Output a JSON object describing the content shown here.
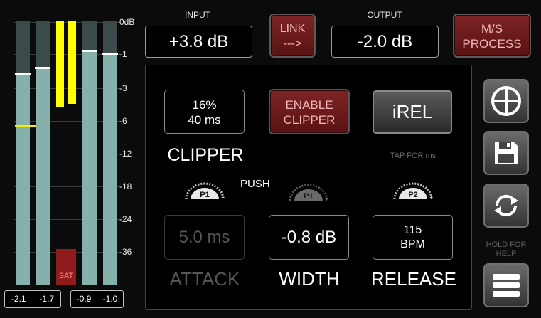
{
  "meters": {
    "scale": [
      "0dB",
      "-1",
      "-3",
      "-6",
      "-12",
      "-18",
      "-24",
      "-36"
    ],
    "input_peak_left": "-2.1",
    "input_peak_right": "-1.7",
    "output_peak_left": "-0.9",
    "output_peak_right": "-1.0",
    "sat_label": "SAT"
  },
  "top": {
    "input_caption": "INPUT",
    "input_value": "+3.8 dB",
    "link_line1": "LINK",
    "link_line2": "--->",
    "output_caption": "OUTPUT",
    "output_value": "-2.0 dB",
    "ms_line1": "M/S",
    "ms_line2": "PROCESS"
  },
  "panel": {
    "clipper_value_line1": "16%",
    "clipper_value_line2": "40 ms",
    "enable_clipper_line1": "ENABLE",
    "enable_clipper_line2": "CLIPPER",
    "irel_label": "iREL",
    "clipper_label": "CLIPPER",
    "tap_for_ms": "TAP FOR ms",
    "push_label": "PUSH",
    "knob1_label": "P1",
    "knob2_label": "P1",
    "knob3_label": "P2",
    "attack_value": "5.0 ms",
    "width_value": "-0.8 dB",
    "release_value_line1": "115",
    "release_value_line2": "BPM",
    "attack_label": "ATTACK",
    "width_label": "WIDTH",
    "release_label": "RELEASE"
  },
  "side": {
    "hold_for_help": "HOLD FOR HELP",
    "icons": [
      "quadrant-icon",
      "save-icon",
      "sync-icon",
      "menu-icon"
    ]
  }
}
